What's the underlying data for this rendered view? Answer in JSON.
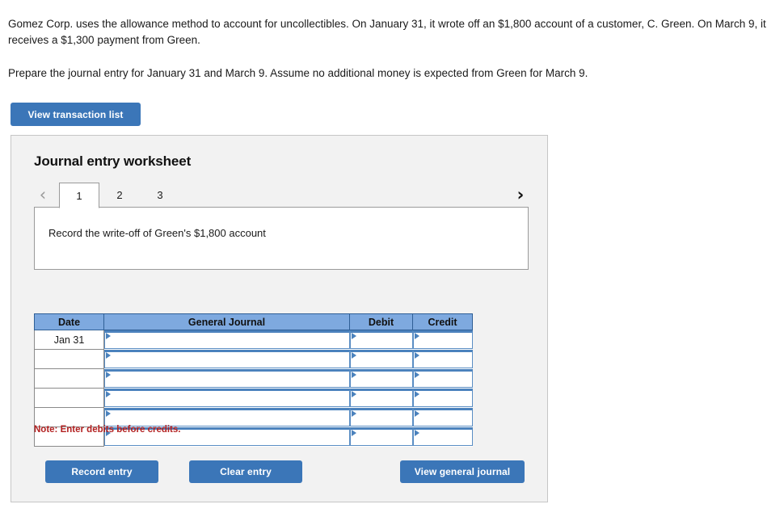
{
  "problem": {
    "paragraph1": "Gomez Corp. uses the allowance method to account for uncollectibles. On January 31, it wrote off an $1,800 account of a customer, C. Green. On March 9, it receives a $1,300 payment from Green.",
    "paragraph2": "Prepare the journal entry for January 31 and March 9. Assume no additional money is expected from Green for March 9."
  },
  "toolbar": {
    "view_transaction_list_label": "View transaction list"
  },
  "worksheet": {
    "title": "Journal entry worksheet",
    "nav": {
      "prev_icon": "chevron-left-icon",
      "next_icon": "chevron-right-icon",
      "prev_glyph": "‹",
      "next_glyph": "›"
    },
    "tabs": [
      {
        "label": "1",
        "active": true
      },
      {
        "label": "2",
        "active": false
      },
      {
        "label": "3",
        "active": false
      }
    ],
    "description": "Record the write-off of Green's $1,800 account",
    "note": "Note: Enter debits before credits.",
    "table": {
      "columns": [
        "Date",
        "General Journal",
        "Debit",
        "Credit"
      ],
      "rows": [
        {
          "date": "Jan 31",
          "general_journal": "",
          "debit": "",
          "credit": ""
        },
        {
          "date": "",
          "general_journal": "",
          "debit": "",
          "credit": ""
        },
        {
          "date": "",
          "general_journal": "",
          "debit": "",
          "credit": ""
        },
        {
          "date": "",
          "general_journal": "",
          "debit": "",
          "credit": ""
        },
        {
          "date": "",
          "general_journal": "",
          "debit": "",
          "credit": ""
        },
        {
          "date": "",
          "general_journal": "",
          "debit": "",
          "credit": ""
        }
      ]
    },
    "footer": {
      "record_entry_label": "Record entry",
      "clear_entry_label": "Clear entry",
      "view_general_journal_label": "View general journal"
    }
  },
  "colors": {
    "button_blue": "#3b76b8",
    "table_header_blue": "#7ea9df",
    "panel_bg": "#f2f2f2",
    "note_red": "#b32121",
    "cell_accent_blue": "#4b82bd"
  }
}
